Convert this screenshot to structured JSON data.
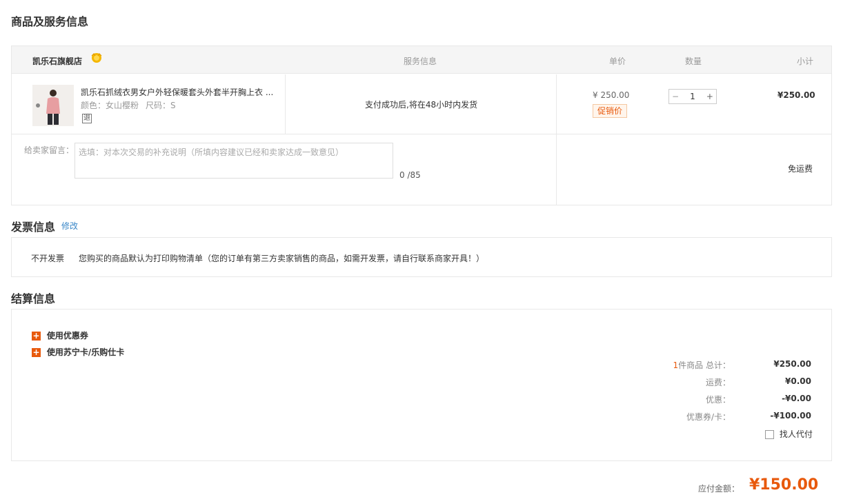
{
  "sections": {
    "goods_title": "商品及服务信息",
    "invoice_title": "发票信息",
    "invoice_edit": "修改",
    "settle_title": "结算信息"
  },
  "table_header": {
    "store_name": "凯乐石旗舰店",
    "service": "服务信息",
    "unit_price": "单价",
    "quantity": "数量",
    "subtotal": "小计"
  },
  "item": {
    "name": "凯乐石抓绒衣男女户外轻保暖套头外套半开胸上衣 ...",
    "color": "颜色：女山樱粉",
    "size": "尺码：S",
    "return_badge": "退",
    "service_info": "支付成功后,将在48小时内发货",
    "price": "¥ 250.00",
    "promo_tag": "促销价",
    "qty_minus": "−",
    "qty_value": "1",
    "qty_plus": "+",
    "subtotal": "¥250.00"
  },
  "message": {
    "label": "给卖家留言：",
    "placeholder": "选填：对本次交易的补充说明（所填内容建议已经和卖家达成一致意见）",
    "counter": "0 /85",
    "shipping": "免运费"
  },
  "invoice": {
    "type": "不开发票",
    "note": "您购买的商品默认为打印购物清单（您的订单有第三方卖家销售的商品，如需开发票，请自行联系商家开具！）"
  },
  "settlement": {
    "coupon_label": "使用优惠券",
    "card_label": "使用苏宁卡/乐购仕卡",
    "plus_glyph": "+",
    "count": "1",
    "count_suffix": "件商品 总计：",
    "total": "¥250.00",
    "shipping_label": "运费：",
    "shipping": "¥0.00",
    "discount_label": "优惠：",
    "discount": "-¥0.00",
    "coupon_card_label": "优惠券/卡：",
    "coupon_card": "-¥100.00",
    "proxy_pay": "找人代付",
    "payable_label": "应付金额：",
    "payable": "¥150.00"
  },
  "colors": {
    "accent": "#e8590c",
    "link": "#3a87c8",
    "badge": "#f5b700"
  }
}
